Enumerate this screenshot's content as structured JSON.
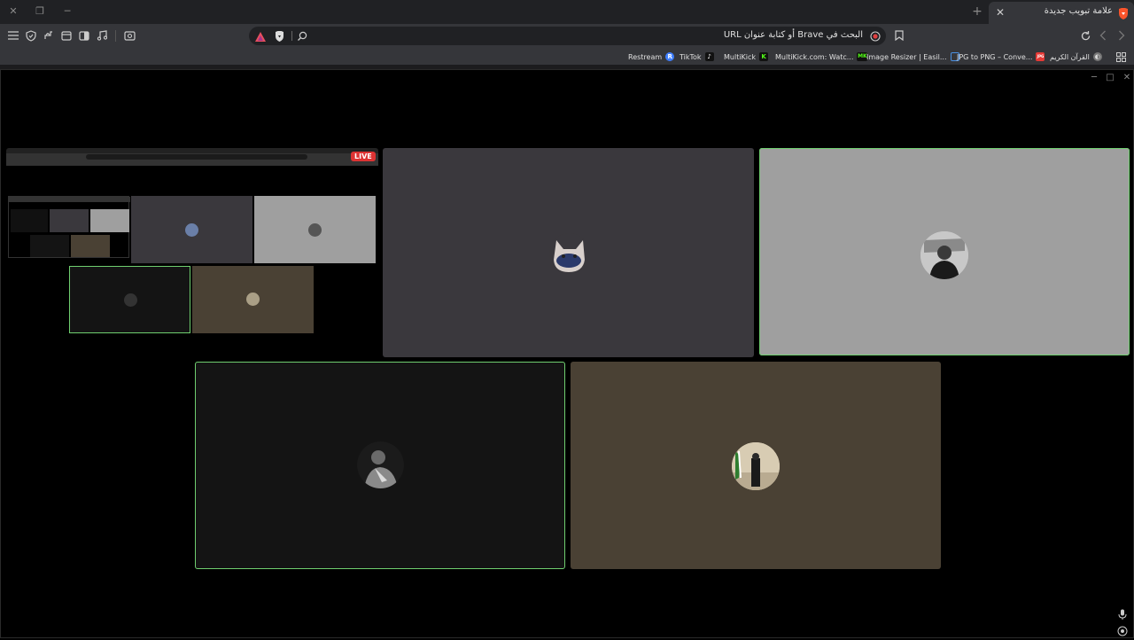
{
  "window": {
    "close_glyph": "✕",
    "restore_glyph": "❐",
    "minimize_glyph": "─"
  },
  "tab": {
    "title": "علامة تبويب جديدة",
    "close_glyph": "✕",
    "new_tab_glyph": "+"
  },
  "toolbar": {
    "url_placeholder": "البحث في Brave أو كتابة عنوان URL",
    "icons": [
      "menu-icon",
      "shield-icon",
      "extensions-icon",
      "tabs-icon",
      "sidebar-icon",
      "music-icon",
      "screenshot-icon",
      "brave-rewards-icon",
      "brave-shield-icon",
      "search-icon",
      "record-icon",
      "bookmark-icon",
      "reload-icon",
      "back-icon",
      "forward-icon"
    ]
  },
  "bookmarks": [
    {
      "label": "Restream",
      "icon_text": "R",
      "icon_color": "#3f7fff"
    },
    {
      "label": "TikTok",
      "icon_text": "♪",
      "icon_color": "#111111"
    },
    {
      "label": "MultiKick",
      "icon_text": "K",
      "icon_color": "#53fc18"
    },
    {
      "label": "MultiKick.com: Watc...",
      "icon_text": "MK",
      "icon_color": "#53fc18"
    },
    {
      "label": "Image Resizer | Easil...",
      "icon_text": "",
      "icon_color": "#4a90e2"
    },
    {
      "label": "JPG to PNG – Conve...",
      "icon_text": "JPG",
      "icon_color": "#e53935"
    },
    {
      "label": "القرآن الكريم",
      "icon_text": "◐",
      "icon_color": "#888888"
    }
  ],
  "meeting": {
    "live_label": "LIVE",
    "tile_colors": {
      "screen_share": "#000000",
      "participant_1": "#3a383d",
      "participant_2": "#9f9f9f",
      "participant_3": "#141414",
      "participant_4": "#4a4134",
      "speaking_border": "#6fcf6f"
    }
  }
}
